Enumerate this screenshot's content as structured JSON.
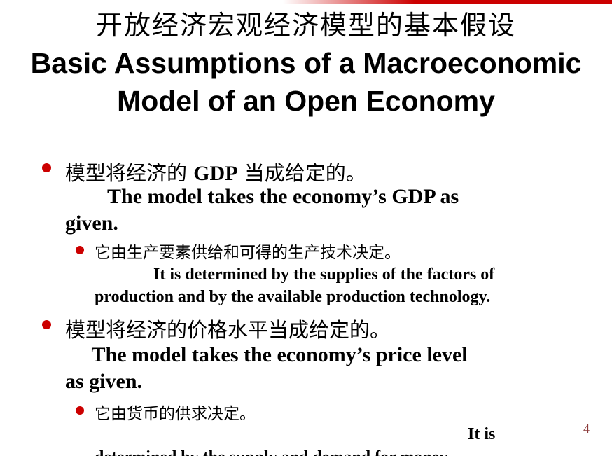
{
  "title": {
    "zh": "开放经济宏观经济模型的基本假设",
    "en_line1": "Basic Assumptions of a Macroeconomic",
    "en_line2": "Model of an Open Economy"
  },
  "bullets": [
    {
      "zh_pre": "模型将经济的 ",
      "zh_gdp": "GDP",
      "zh_post": " 当成给定的。",
      "en": "        The model takes the economy’s GDP as\ngiven.",
      "sub": {
        "zh": "它由生产要素供给和可得的生产技术决定。",
        "en": "              It is determined by the supplies of the factors of\nproduction and by the available production technology."
      }
    },
    {
      "zh": "模型将经济的价格水平当成给定的。",
      "en": "     The model takes the economy’s price level\nas given.",
      "sub": {
        "zh": "它由货币的供求决定。",
        "en_line1": "It is",
        "en_line2": "determined by the supply and demand for money."
      }
    }
  ],
  "page_number": "4",
  "colors": {
    "bullet": "#cc0000",
    "accent": "#cc0000",
    "page_number": "#8b3a3a"
  }
}
